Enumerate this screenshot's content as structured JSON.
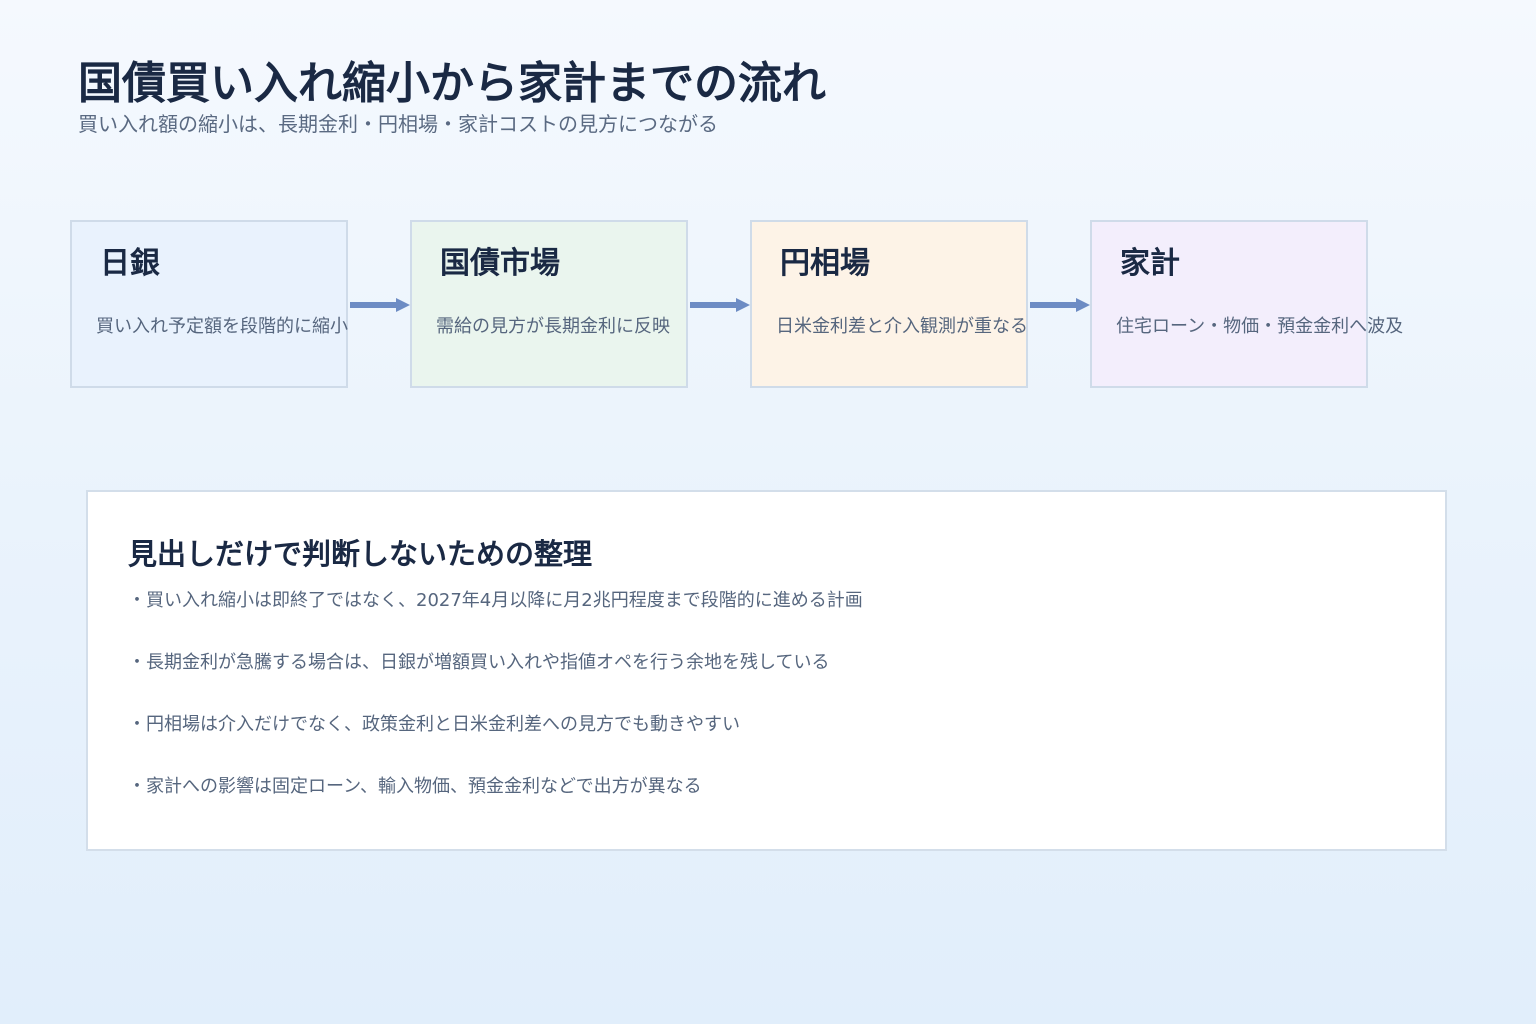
{
  "header": {
    "title": "国債買い入れ縮小から家計までの流れ",
    "subtitle": "買い入れ額の縮小は、長期金利・円相場・家計コストの見方につながる"
  },
  "flow": {
    "nodes": [
      {
        "title": "日銀",
        "description": "買い入れ予定額を段階的に縮小",
        "color": "#e9f2fd"
      },
      {
        "title": "国債市場",
        "description": "需給の見方が長期金利に反映",
        "color": "#eaf5ee"
      },
      {
        "title": "円相場",
        "description": "日米金利差と介入観測が重なる",
        "color": "#fdf3e7"
      },
      {
        "title": "家計",
        "description": "住宅ローン・物価・預金金利へ波及",
        "color": "#f3eefc"
      }
    ],
    "arrow_color": "#6d8cc4"
  },
  "notes": {
    "title": "見出しだけで判断しないための整理",
    "items": [
      "・買い入れ縮小は即終了ではなく、2027年4月以降に月2兆円程度まで段階的に進める計画",
      "・長期金利が急騰する場合は、日銀が増額買い入れや指値オペを行う余地を残している",
      "・円相場は介入だけでなく、政策金利と日米金利差への見方でも動きやすい",
      "・家計への影響は固定ローン、輸入物価、預金金利などで出方が異なる"
    ]
  }
}
